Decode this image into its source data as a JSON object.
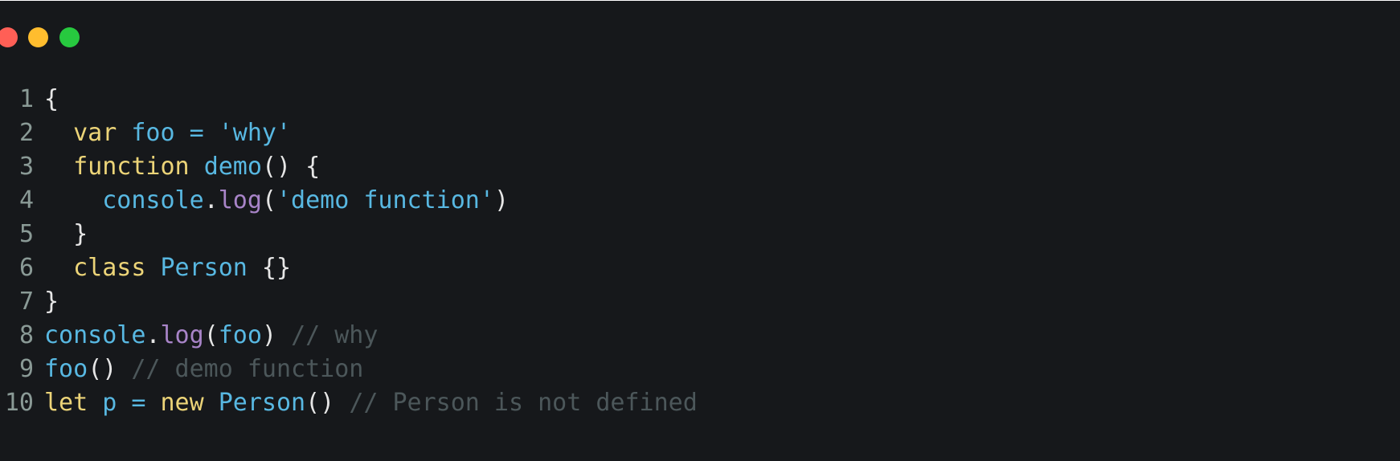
{
  "window": {
    "controls": [
      "close",
      "minimize",
      "maximize"
    ],
    "colors": {
      "close": "#ff5f56",
      "minimize": "#ffbd2e",
      "maximize": "#27c93f",
      "background": "#16181b"
    }
  },
  "code": {
    "language": "javascript",
    "lines": [
      {
        "n": "1",
        "tokens": [
          {
            "t": "{",
            "c": "punc"
          }
        ]
      },
      {
        "n": "2",
        "tokens": [
          {
            "t": "  ",
            "c": "punc"
          },
          {
            "t": "var",
            "c": "kw"
          },
          {
            "t": " ",
            "c": "punc"
          },
          {
            "t": "foo",
            "c": "id"
          },
          {
            "t": " ",
            "c": "punc"
          },
          {
            "t": "=",
            "c": "op"
          },
          {
            "t": " ",
            "c": "punc"
          },
          {
            "t": "'why'",
            "c": "str"
          }
        ]
      },
      {
        "n": "3",
        "tokens": [
          {
            "t": "  ",
            "c": "punc"
          },
          {
            "t": "function",
            "c": "kw"
          },
          {
            "t": " ",
            "c": "punc"
          },
          {
            "t": "demo",
            "c": "fn"
          },
          {
            "t": "() {",
            "c": "punc"
          }
        ]
      },
      {
        "n": "4",
        "tokens": [
          {
            "t": "    ",
            "c": "punc"
          },
          {
            "t": "console",
            "c": "id"
          },
          {
            "t": ".",
            "c": "punc"
          },
          {
            "t": "log",
            "c": "method"
          },
          {
            "t": "(",
            "c": "punc"
          },
          {
            "t": "'demo function'",
            "c": "str"
          },
          {
            "t": ")",
            "c": "punc"
          }
        ]
      },
      {
        "n": "5",
        "tokens": [
          {
            "t": "  }",
            "c": "punc"
          }
        ]
      },
      {
        "n": "6",
        "tokens": [
          {
            "t": "  ",
            "c": "punc"
          },
          {
            "t": "class",
            "c": "kw"
          },
          {
            "t": " ",
            "c": "punc"
          },
          {
            "t": "Person",
            "c": "id"
          },
          {
            "t": " {}",
            "c": "punc"
          }
        ]
      },
      {
        "n": "7",
        "tokens": [
          {
            "t": "}",
            "c": "punc"
          }
        ]
      },
      {
        "n": "8",
        "tokens": [
          {
            "t": "console",
            "c": "id"
          },
          {
            "t": ".",
            "c": "punc"
          },
          {
            "t": "log",
            "c": "method"
          },
          {
            "t": "(",
            "c": "punc"
          },
          {
            "t": "foo",
            "c": "id"
          },
          {
            "t": ") ",
            "c": "punc"
          },
          {
            "t": "// why",
            "c": "com"
          }
        ]
      },
      {
        "n": "9",
        "tokens": [
          {
            "t": "foo",
            "c": "fn"
          },
          {
            "t": "() ",
            "c": "punc"
          },
          {
            "t": "// demo function",
            "c": "com"
          }
        ]
      },
      {
        "n": "10",
        "tokens": [
          {
            "t": "let",
            "c": "kw"
          },
          {
            "t": " ",
            "c": "punc"
          },
          {
            "t": "p",
            "c": "id"
          },
          {
            "t": " ",
            "c": "punc"
          },
          {
            "t": "=",
            "c": "op"
          },
          {
            "t": " ",
            "c": "punc"
          },
          {
            "t": "new",
            "c": "kw"
          },
          {
            "t": " ",
            "c": "punc"
          },
          {
            "t": "Person",
            "c": "id"
          },
          {
            "t": "() ",
            "c": "punc"
          },
          {
            "t": "// Person is not defined",
            "c": "com"
          }
        ]
      }
    ]
  }
}
